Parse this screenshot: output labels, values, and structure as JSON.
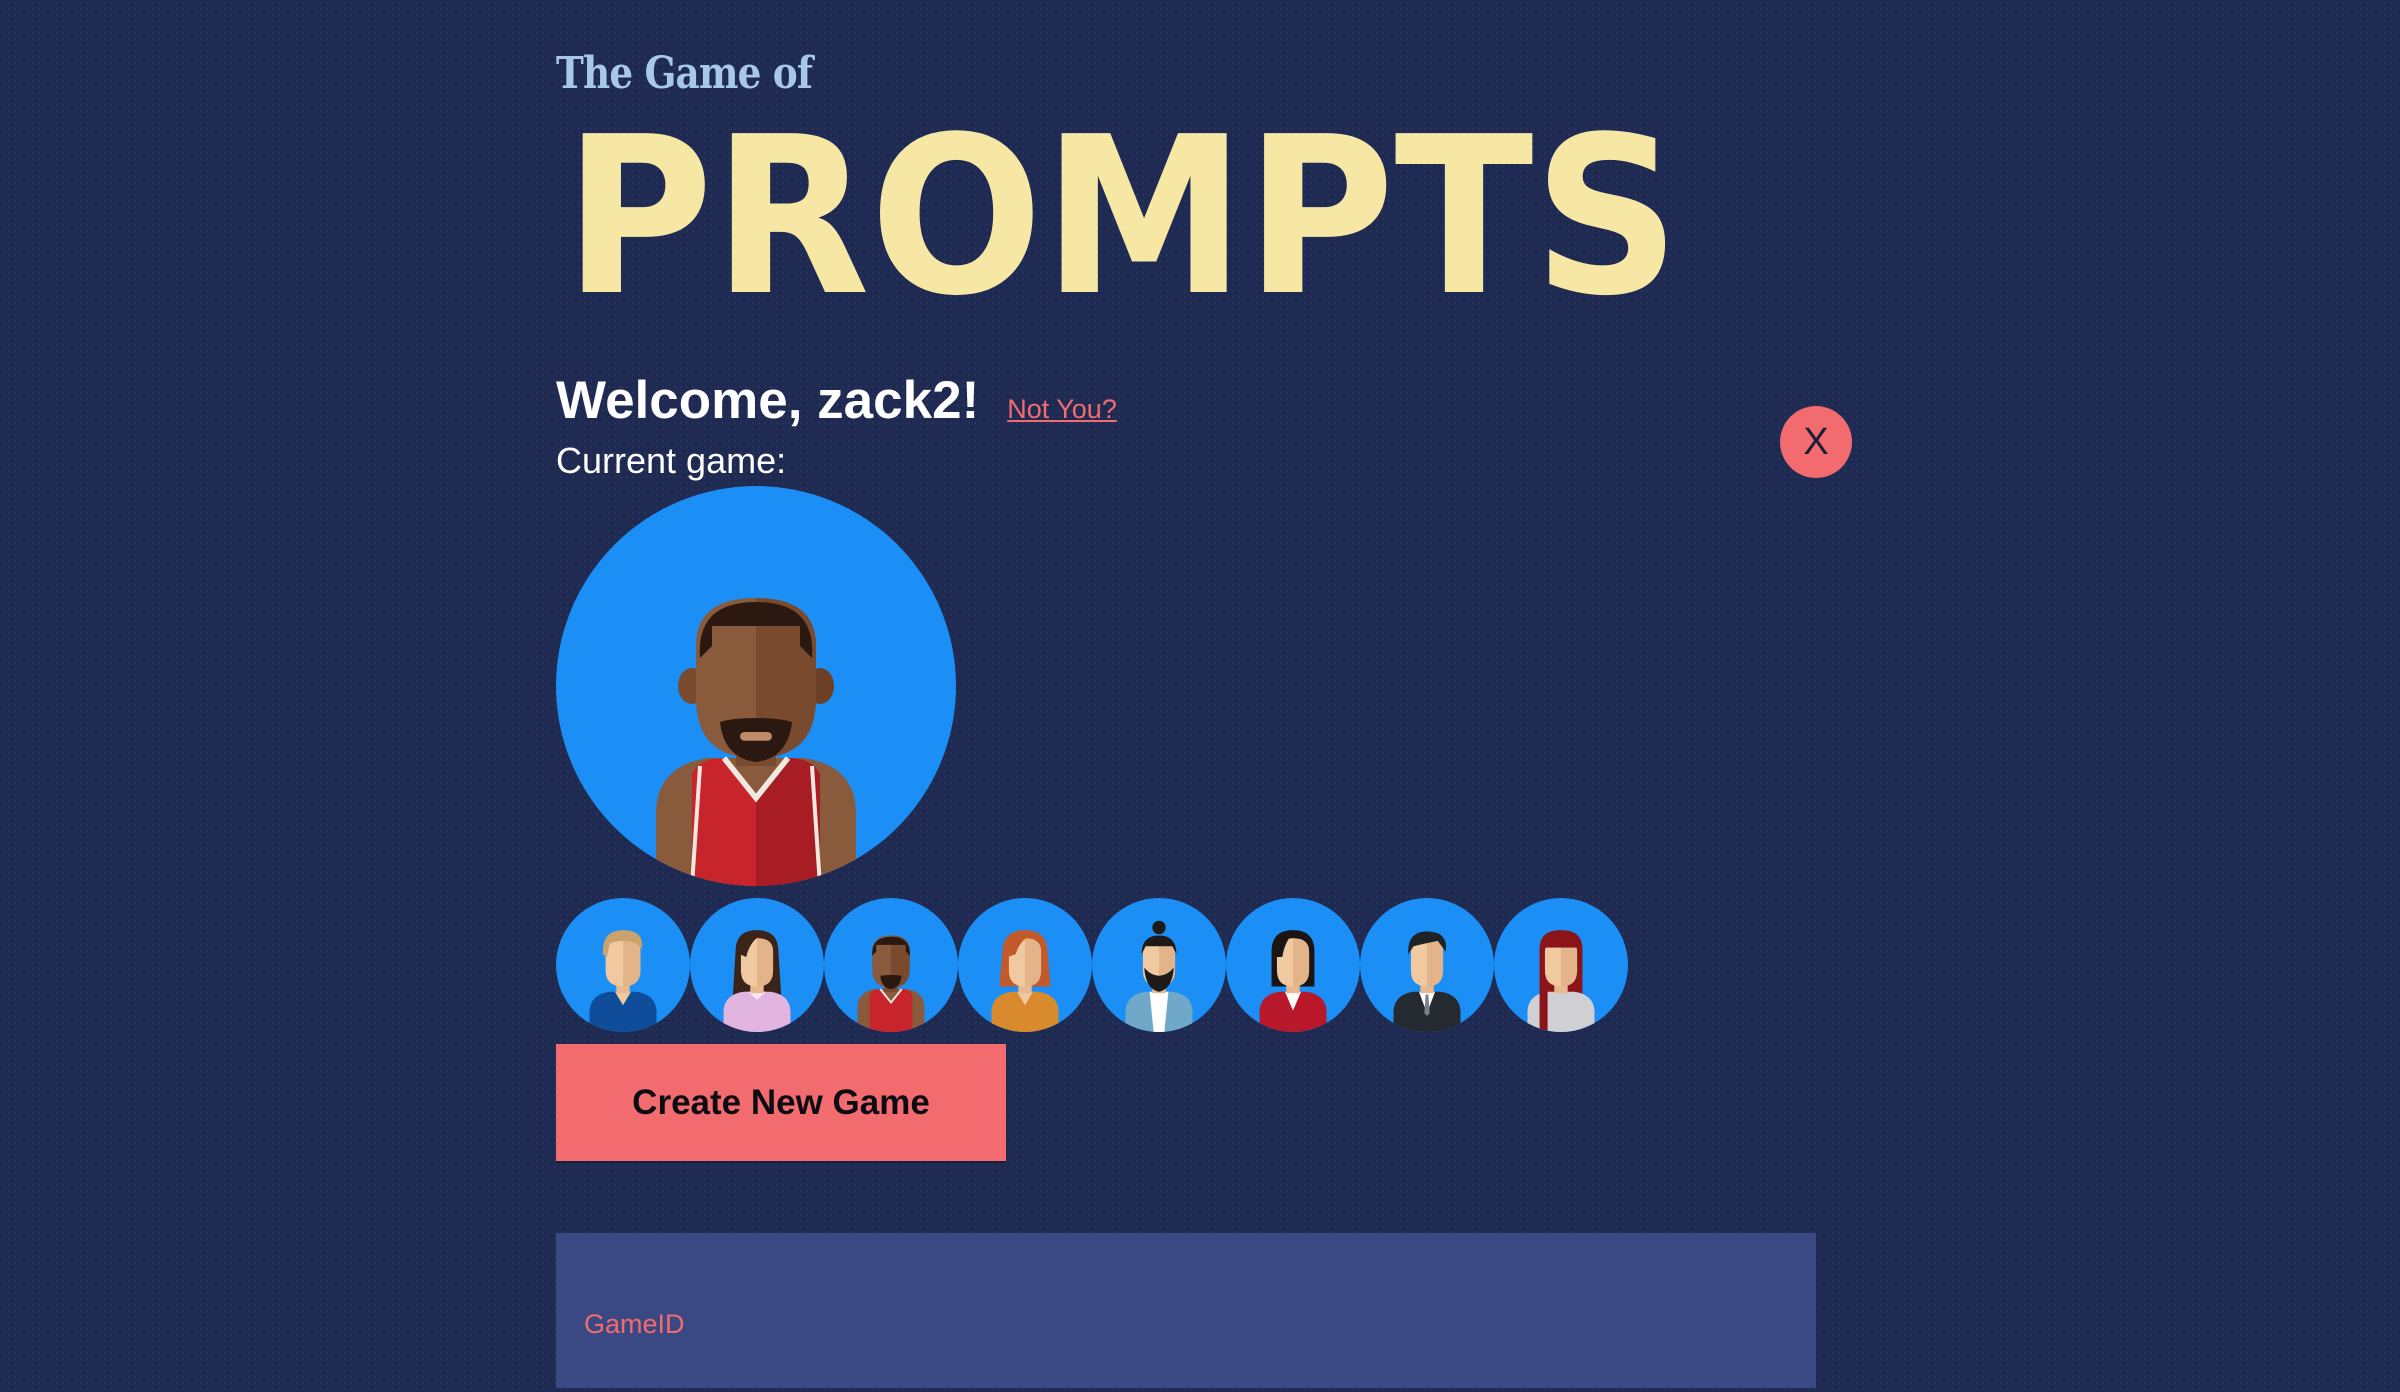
{
  "header": {
    "subtitle": "The Game of",
    "logo_text": "PROMPTS"
  },
  "user": {
    "welcome": "Welcome, zack2!",
    "not_you_link": "Not You?"
  },
  "game": {
    "current_game_label": "Current game:",
    "close_button": "X",
    "selected_avatar": "basketball-player",
    "avatar_options": [
      "blond-man-blue-shirt",
      "woman-lavender-top",
      "basketball-player",
      "redhead-woman-orange-jacket",
      "bearded-man-topknot",
      "woman-red-blazer",
      "man-in-suit",
      "woman-red-hair-white-top"
    ],
    "create_button": "Create New Game",
    "gameid_placeholder": "GameID"
  },
  "colors": {
    "background": "#1f2a52",
    "accent": "#f26b6e",
    "logo": "#f7e7a5",
    "subtitle": "#a8c8ea",
    "avatar_circle": "#1b8ff5",
    "input_background": "#3a4983"
  }
}
